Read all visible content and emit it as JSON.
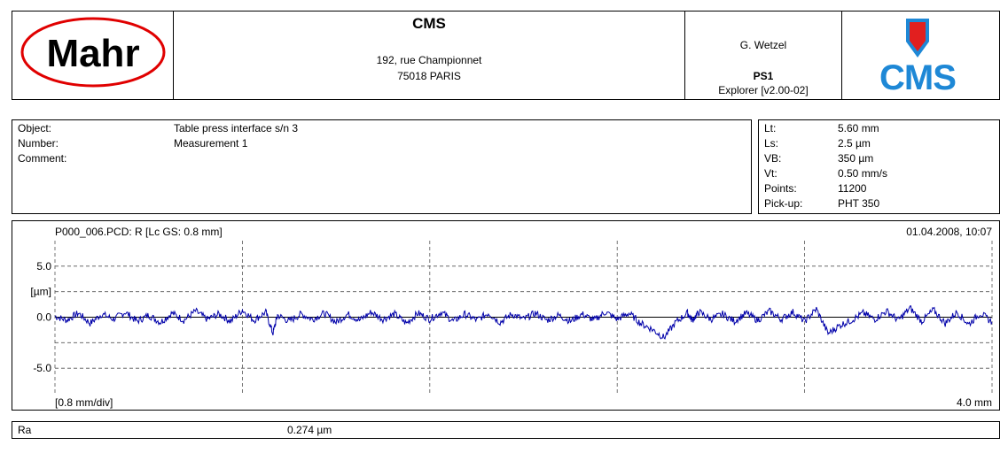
{
  "header": {
    "logo_left_text": "Mahr",
    "company": "CMS",
    "address_line1": "192, rue Championnet",
    "address_line2": "75018 PARIS",
    "operator": "G. Wetzel",
    "program": "PS1",
    "software": "Explorer [v2.00-02]",
    "logo_right_text": "CMS"
  },
  "info": {
    "rows": [
      {
        "label": "Object:",
        "value": "Table press interface s/n 3"
      },
      {
        "label": "Number:",
        "value": "Measurement 1"
      },
      {
        "label": "Comment:",
        "value": ""
      }
    ]
  },
  "params": {
    "rows": [
      {
        "label": "Lt:",
        "value": "5.60 mm"
      },
      {
        "label": "Ls:",
        "value": "2.5 µm"
      },
      {
        "label": "VB:",
        "value": "350 µm"
      },
      {
        "label": "Vt:",
        "value": "0.50 mm/s"
      },
      {
        "label": "Points:",
        "value": "11200"
      },
      {
        "label": "Pick-up:",
        "value": "PHT 350"
      }
    ]
  },
  "profile": {
    "file_label": "P000_006.PCD: R [Lc GS: 0.8 mm]",
    "timestamp": "01.04.2008, 10:07",
    "x_scale_label": "[0.8 mm/div]",
    "x_end_label": "4.0 mm",
    "y_unit_label": "[µm]"
  },
  "chart_data": {
    "type": "line",
    "title": "P000_006.PCD: R [Lc GS: 0.8 mm]",
    "xlabel": "[0.8 mm/div]",
    "ylabel": "[µm]",
    "xlim": [
      0,
      4.0
    ],
    "ylim": [
      -7.5,
      7.5
    ],
    "yticks": [
      5.0,
      0.0,
      -5.0
    ],
    "ytick_labels": [
      "5.0",
      "0.0",
      "-5.0"
    ],
    "grid": true,
    "line_color": "#0000aa",
    "series": [
      {
        "x": [
          0.0,
          0.05,
          0.1,
          0.15,
          0.2,
          0.25,
          0.3,
          0.35,
          0.4,
          0.45,
          0.5,
          0.55,
          0.6,
          0.65,
          0.7,
          0.75,
          0.8,
          0.85,
          0.9,
          0.93,
          0.95,
          1.0,
          1.05,
          1.1,
          1.15,
          1.2,
          1.25,
          1.3,
          1.35,
          1.4,
          1.45,
          1.5,
          1.55,
          1.6,
          1.65,
          1.7,
          1.75,
          1.8,
          1.85,
          1.9,
          1.95,
          2.0,
          2.05,
          2.1,
          2.15,
          2.2,
          2.25,
          2.3,
          2.35,
          2.4,
          2.45,
          2.5,
          2.55,
          2.6,
          2.65,
          2.7,
          2.72,
          2.75,
          2.8,
          2.85,
          2.9,
          2.95,
          3.0,
          3.05,
          3.1,
          3.15,
          3.2,
          3.25,
          3.3,
          3.35,
          3.4,
          3.45,
          3.5,
          3.55,
          3.6,
          3.65,
          3.7,
          3.75,
          3.8,
          3.85,
          3.9,
          3.95,
          4.0
        ],
        "values": [
          0.1,
          -0.3,
          0.4,
          -0.6,
          0.3,
          -0.2,
          0.5,
          -0.4,
          0.2,
          -0.5,
          0.4,
          -0.3,
          0.6,
          -0.2,
          0.3,
          -0.4,
          0.7,
          -0.3,
          0.5,
          -1.6,
          0.2,
          -0.4,
          0.3,
          -0.2,
          0.4,
          -0.5,
          0.3,
          -0.3,
          0.5,
          -0.2,
          0.3,
          -0.6,
          0.4,
          -0.2,
          0.5,
          -0.4,
          0.3,
          -0.3,
          0.4,
          -0.5,
          0.3,
          -0.2,
          0.4,
          -0.3,
          0.2,
          -0.4,
          0.3,
          -0.3,
          0.5,
          -0.2,
          0.4,
          -0.6,
          -1.2,
          -2.0,
          -0.5,
          0.4,
          -0.3,
          0.5,
          -0.2,
          0.3,
          -0.4,
          0.4,
          -0.3,
          0.6,
          -0.2,
          0.5,
          -0.4,
          0.8,
          -1.6,
          -0.8,
          -0.3,
          0.4,
          -0.2,
          0.6,
          -0.3,
          0.9,
          -0.4,
          0.7,
          -0.6,
          0.5,
          -0.7,
          0.4,
          -0.5
        ]
      }
    ]
  },
  "result": {
    "label": "Ra",
    "value": "0.274 µm"
  }
}
